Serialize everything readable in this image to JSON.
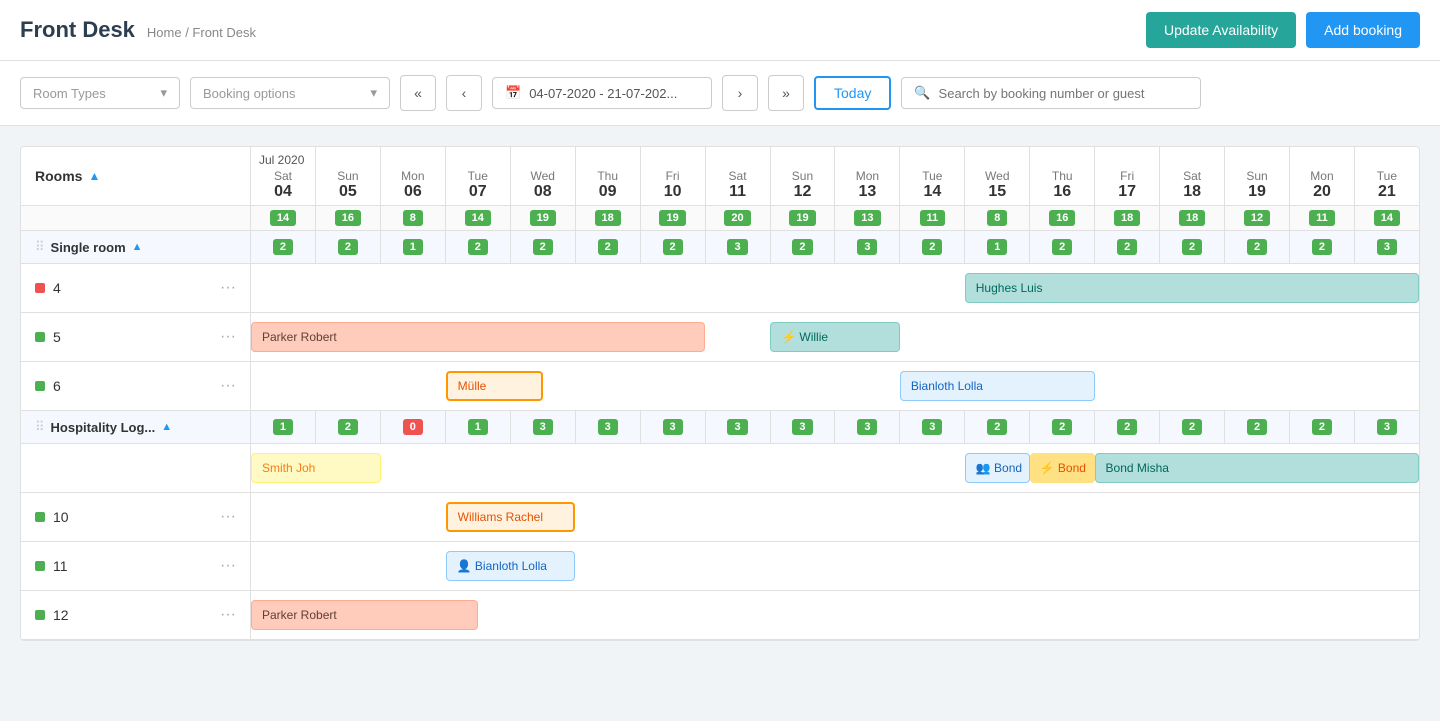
{
  "header": {
    "title": "Front Desk",
    "breadcrumb": "Home / Front Desk",
    "btn_update": "Update Availability",
    "btn_add": "Add booking"
  },
  "toolbar": {
    "room_types_placeholder": "Room Types",
    "booking_options_placeholder": "Booking options",
    "date_range": "04-07-2020 - 21-07-202...",
    "today_label": "Today",
    "search_placeholder": "Search by booking number or guest"
  },
  "calendar": {
    "month_label": "Jul 2020",
    "days": [
      {
        "name": "Sat",
        "num": "04"
      },
      {
        "name": "Sun",
        "num": "05"
      },
      {
        "name": "Mon",
        "num": "06"
      },
      {
        "name": "Tue",
        "num": "07"
      },
      {
        "name": "Wed",
        "num": "08"
      },
      {
        "name": "Thu",
        "num": "09"
      },
      {
        "name": "Fri",
        "num": "10"
      },
      {
        "name": "Sat",
        "num": "11"
      },
      {
        "name": "Sun",
        "num": "12"
      },
      {
        "name": "Mon",
        "num": "13"
      },
      {
        "name": "Tue",
        "num": "14"
      },
      {
        "name": "Wed",
        "num": "15"
      },
      {
        "name": "Thu",
        "num": "16"
      },
      {
        "name": "Fri",
        "num": "17"
      },
      {
        "name": "Sat",
        "num": "18"
      },
      {
        "name": "Sun",
        "num": "19"
      },
      {
        "name": "Mon",
        "num": "20"
      },
      {
        "name": "Tue",
        "num": "21"
      }
    ],
    "top_avail": [
      14,
      16,
      8,
      14,
      19,
      18,
      19,
      20,
      19,
      13,
      11,
      8,
      16,
      18,
      18,
      12,
      11,
      14
    ],
    "rooms_label": "Rooms",
    "groups": [
      {
        "name": "Single room",
        "avail": [
          2,
          2,
          1,
          2,
          2,
          2,
          2,
          3,
          2,
          3,
          2,
          1,
          2,
          2,
          2,
          2,
          2,
          3
        ],
        "avail_colors": [
          "green",
          "green",
          "green",
          "green",
          "green",
          "green",
          "green",
          "green",
          "green",
          "green",
          "green",
          "green",
          "green",
          "green",
          "green",
          "green",
          "green",
          "green"
        ],
        "rooms": [
          {
            "num": "4",
            "color": "red",
            "bookings": [
              {
                "label": "Hughes Luis",
                "start": 11,
                "span": 7,
                "style": "teal"
              }
            ]
          },
          {
            "num": "5",
            "color": "green",
            "bookings": [
              {
                "label": "Parker Robert",
                "start": 0,
                "span": 7,
                "style": "peach"
              },
              {
                "label": "⚡ Willie",
                "start": 8,
                "span": 2,
                "style": "teal"
              }
            ]
          },
          {
            "num": "6",
            "color": "green",
            "bookings": [
              {
                "label": "Mülle",
                "start": 3,
                "span": 1.5,
                "style": "orange-outline"
              },
              {
                "label": "Bianloth Lolla",
                "start": 10,
                "span": 3,
                "style": "blue-outline"
              }
            ]
          }
        ]
      },
      {
        "name": "Hospitality Log...",
        "avail": [
          1,
          2,
          0,
          1,
          3,
          3,
          3,
          3,
          3,
          3,
          3,
          2,
          2,
          2,
          2,
          2,
          2,
          3
        ],
        "avail_colors": [
          "green",
          "green",
          "red",
          "green",
          "green",
          "green",
          "green",
          "green",
          "green",
          "green",
          "green",
          "green",
          "green",
          "green",
          "green",
          "green",
          "green",
          "green"
        ],
        "rooms": [
          {
            "num": "10",
            "color": "green",
            "bookings": [
              {
                "label": "Williams Rachel",
                "start": 3,
                "span": 2,
                "style": "orange-outline"
              }
            ]
          },
          {
            "num": "11",
            "color": "green",
            "bookings": [
              {
                "label": "👤 Bianloth Lolla",
                "start": 3,
                "span": 2,
                "style": "blue-outline"
              }
            ]
          },
          {
            "num": "12",
            "color": "green",
            "bookings": [
              {
                "label": "Parker Robert",
                "start": 0,
                "span": 3.5,
                "style": "peach"
              }
            ]
          }
        ],
        "extra_bookings_row": [
          {
            "label": "Smith Joh",
            "start": 0,
            "span": 2,
            "style": "yellow"
          },
          {
            "label": "👥 Bond",
            "start": 11,
            "span": 1,
            "style": "blue-outline"
          },
          {
            "label": "⚡ Bond",
            "start": 12,
            "span": 1,
            "style": "amber"
          },
          {
            "label": "Bond Misha",
            "start": 13,
            "span": 5,
            "style": "teal"
          }
        ]
      }
    ]
  }
}
